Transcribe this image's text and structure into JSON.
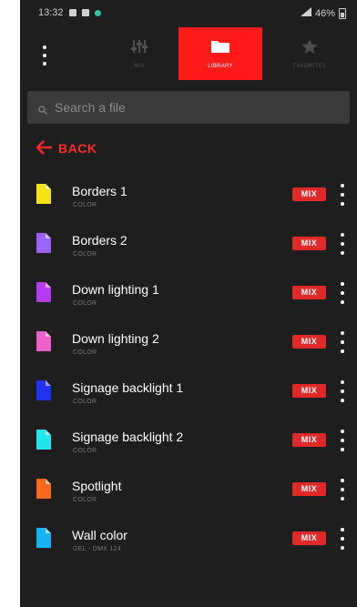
{
  "status_bar": {
    "time": "13:32",
    "signal": "46%"
  },
  "tabs": [
    {
      "label": "Mix",
      "icon": "sliders-icon",
      "active": false
    },
    {
      "label": "Library",
      "icon": "folder-icon",
      "active": true
    },
    {
      "label": "Favorites",
      "icon": "star-icon",
      "active": false
    }
  ],
  "search": {
    "placeholder": "Search a file"
  },
  "back": {
    "label": "BACK"
  },
  "files": [
    {
      "name": "Borders 1",
      "sub": "COLOR",
      "color": "#f5e214",
      "badge": "MIX"
    },
    {
      "name": "Borders 2",
      "sub": "COLOR",
      "color": "#9b63f7",
      "badge": "MIX"
    },
    {
      "name": "Down lighting 1",
      "sub": "COLOR",
      "color": "#b33cf0",
      "badge": "MIX"
    },
    {
      "name": "Down lighting 2",
      "sub": "COLOR",
      "color": "#f061c8",
      "badge": "MIX"
    },
    {
      "name": "Signage backlight 1",
      "sub": "COLOR",
      "color": "#2233f0",
      "badge": "MIX"
    },
    {
      "name": "Signage backlight 2",
      "sub": "COLOR",
      "color": "#24e6f0",
      "badge": "MIX"
    },
    {
      "name": "Spotlight",
      "sub": "COLOR",
      "color": "#fb6a1c",
      "badge": "MIX"
    },
    {
      "name": "Wall color",
      "sub": "GEL - DMX 124",
      "color": "#17b3f0",
      "badge": "MIX"
    }
  ],
  "colors": {
    "accent": "#ff1a1a",
    "background": "#1e1e1e",
    "search_bg": "#3a3a3a"
  }
}
